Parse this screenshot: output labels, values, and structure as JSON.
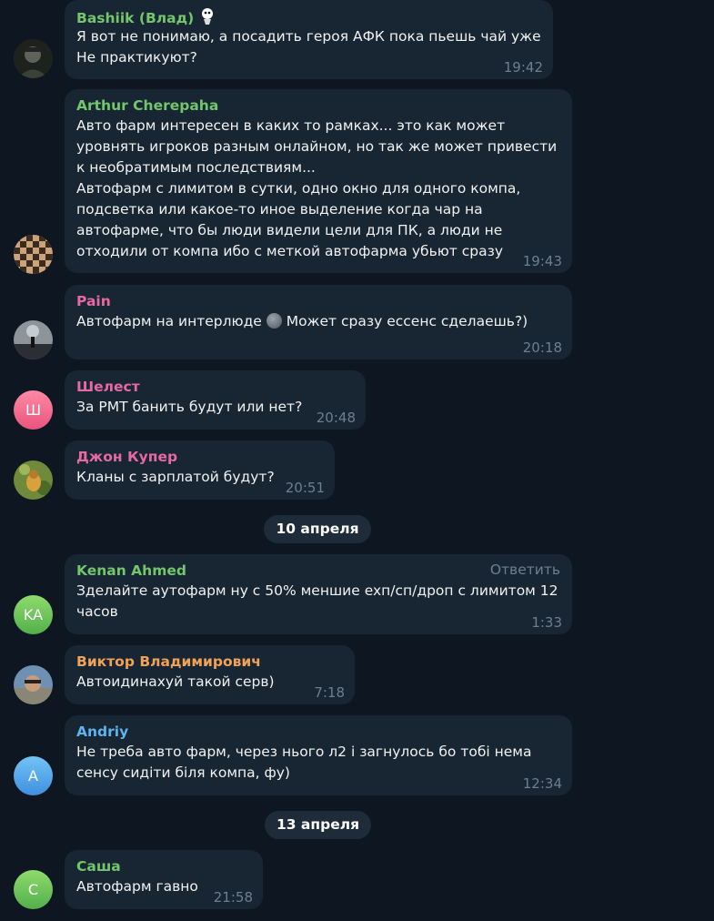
{
  "colors": {
    "background": "#0e1621",
    "bubble": "#182533",
    "time": "#6d7f8f",
    "name_green": "#73c66c",
    "name_pink": "#e56aa2",
    "name_orange": "#f0a257",
    "name_blue": "#5fb3ee"
  },
  "messages": [
    {
      "name": "Bashiik (Влад)",
      "text": "Я вот не понимаю, а посадить героя АФК пока пьешь чай уже\nНе практикуют?",
      "time": "19:42"
    },
    {
      "name": "Arthur Cherepaha",
      "text": "Авто фарм интересен в каких то рамках... это как может\nуровнять игроков разным онлайном, но так же может привести\nк необратимым последствиям...\nАвтофарм с лимитом в сутки, одно окно для одного компа,\nподсветка или какое-то иное выделение когда чар на\nавтофарме, что бы люди видели цели для ПК, а люди не\nотходили от компа ибо с меткой автофарма убьют сразу",
      "time": "19:43"
    },
    {
      "name": "Pain",
      "text_before": "Автофарм на интерлюде ",
      "text_after": " Может сразу ессенс сделаешь?)",
      "time": "20:18"
    },
    {
      "name": "Шелест",
      "text": "За РМТ банить будут или нет?",
      "time": "20:48",
      "avatar_initials": "Ш"
    },
    {
      "name": "Джон Купер",
      "text": "Кланы с зарплатой будут?",
      "time": "20:51"
    },
    {
      "name": "Kenan Ahmed",
      "text": "Зделайте аутофарм ну с 50% меншие exп/сп/дроп с лимитом 12\nчасов",
      "time": "1:33",
      "avatar_initials": "KA",
      "reply_label": "Ответить"
    },
    {
      "name": "Виктор Владимирович",
      "text": "Автоидинахуй такой серв)",
      "time": "7:18"
    },
    {
      "name": "Andriy",
      "text": "Не треба авто фарм, через нього л2 і загнулось бо тобі нема\nсенсу сидіти біля компа, фу)",
      "time": "12:34",
      "avatar_initials": "A"
    },
    {
      "name": "Саша",
      "text": "Автофарм гавно",
      "time": "21:58",
      "avatar_initials": "С"
    }
  ],
  "dates": [
    "10 апреля",
    "13 апреля"
  ]
}
